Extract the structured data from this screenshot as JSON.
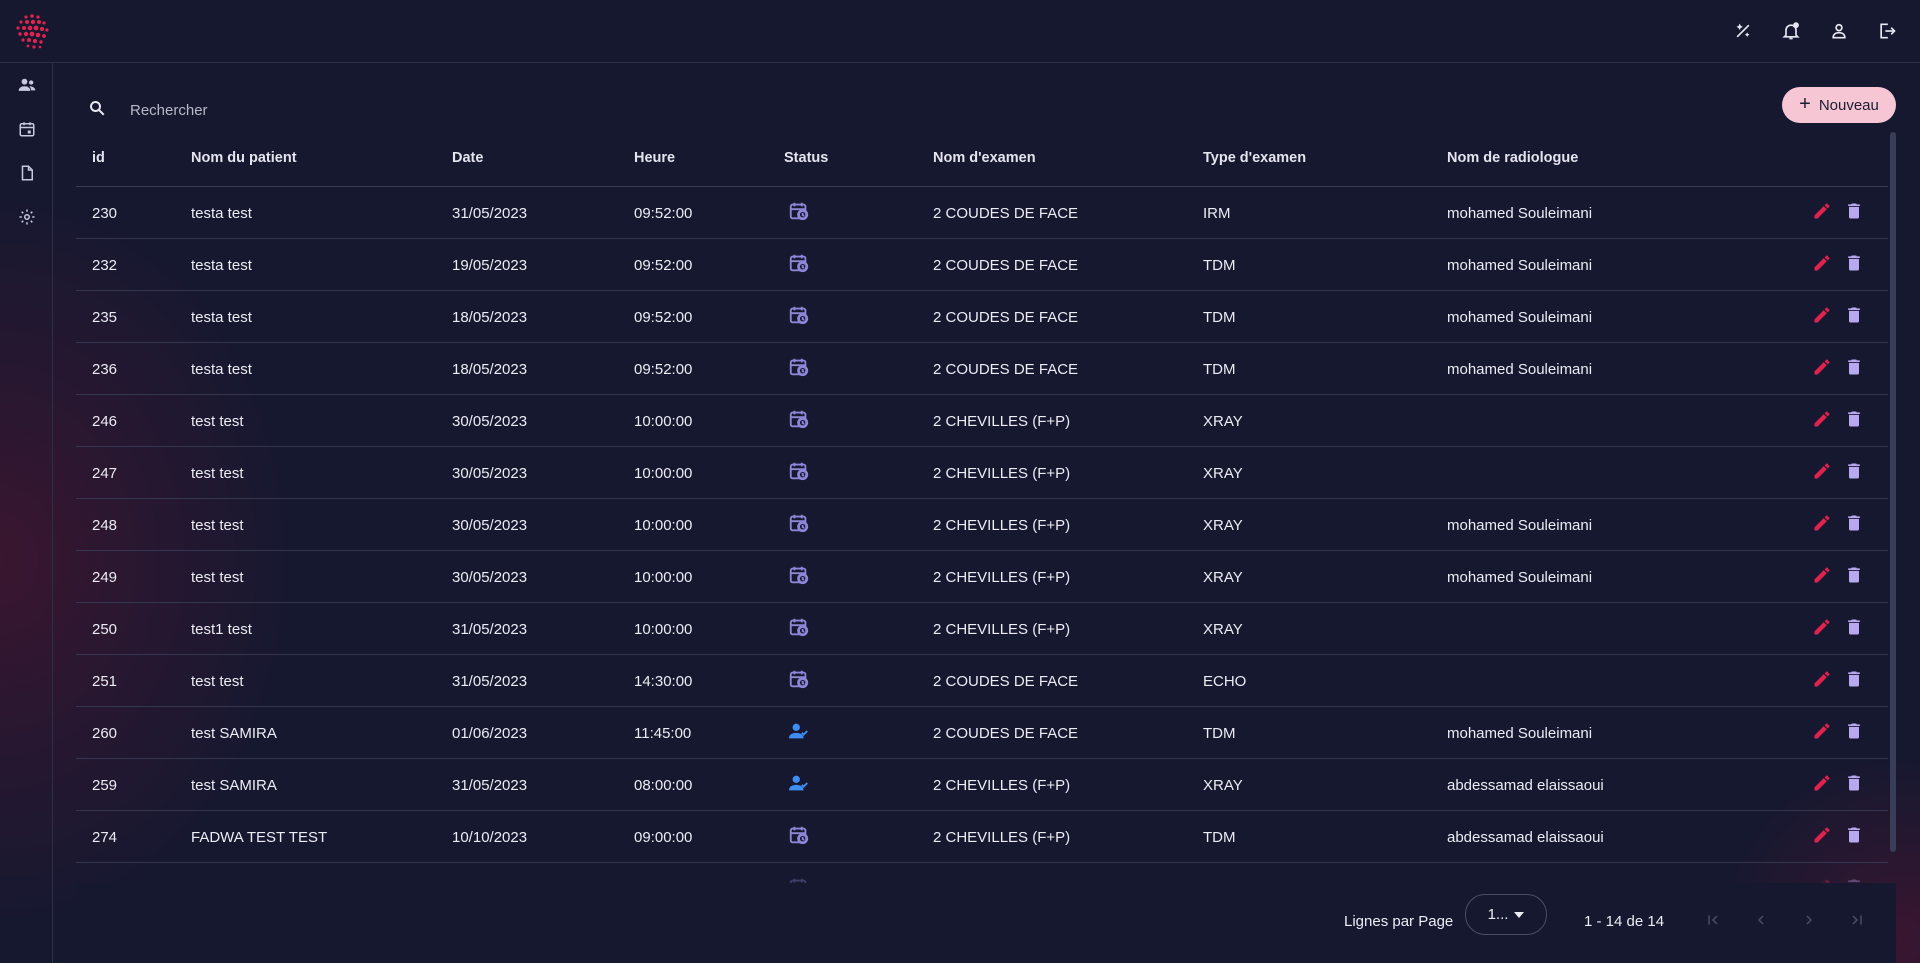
{
  "colors": {
    "background": "#161830",
    "accent_pink": "#f6c6d4",
    "edit_red": "#e0224e",
    "delete_lavender": "#b8a8f0",
    "status_planned": "#8f86d8",
    "status_present": "#3f8cf2"
  },
  "header": {
    "logo_icon": "dotted-sphere-logo",
    "actions": [
      {
        "name": "darkmode-toggle-icon"
      },
      {
        "name": "notifications-icon"
      },
      {
        "name": "profile-icon"
      },
      {
        "name": "logout-icon"
      }
    ]
  },
  "sidebar": {
    "items": [
      {
        "name": "patients-icon"
      },
      {
        "name": "calendar-icon"
      },
      {
        "name": "document-icon"
      },
      {
        "name": "settings-icon"
      }
    ]
  },
  "toolbar": {
    "search_placeholder": "Rechercher",
    "new_label": "Nouveau"
  },
  "table": {
    "columns": [
      "id",
      "Nom du patient",
      "Date",
      "Heure",
      "Status",
      "Nom d'examen",
      "Type d'examen",
      "Nom de radiologue"
    ],
    "rows": [
      {
        "id": "230",
        "patient": "testa test",
        "date": "31/05/2023",
        "heure": "09:52:00",
        "status": "planned",
        "exam": "2 COUDES DE FACE",
        "type": "IRM",
        "radiologue": "mohamed Souleimani"
      },
      {
        "id": "232",
        "patient": "testa test",
        "date": "19/05/2023",
        "heure": "09:52:00",
        "status": "planned",
        "exam": "2 COUDES DE FACE",
        "type": "TDM",
        "radiologue": "mohamed Souleimani"
      },
      {
        "id": "235",
        "patient": "testa test",
        "date": "18/05/2023",
        "heure": "09:52:00",
        "status": "planned",
        "exam": "2 COUDES DE FACE",
        "type": "TDM",
        "radiologue": "mohamed Souleimani"
      },
      {
        "id": "236",
        "patient": "testa test",
        "date": "18/05/2023",
        "heure": "09:52:00",
        "status": "planned",
        "exam": "2 COUDES DE FACE",
        "type": "TDM",
        "radiologue": "mohamed Souleimani"
      },
      {
        "id": "246",
        "patient": "test test",
        "date": "30/05/2023",
        "heure": "10:00:00",
        "status": "planned",
        "exam": "2 CHEVILLES (F+P)",
        "type": "XRAY",
        "radiologue": ""
      },
      {
        "id": "247",
        "patient": "test test",
        "date": "30/05/2023",
        "heure": "10:00:00",
        "status": "planned",
        "exam": "2 CHEVILLES (F+P)",
        "type": "XRAY",
        "radiologue": ""
      },
      {
        "id": "248",
        "patient": "test test",
        "date": "30/05/2023",
        "heure": "10:00:00",
        "status": "planned",
        "exam": "2 CHEVILLES (F+P)",
        "type": "XRAY",
        "radiologue": "mohamed Souleimani"
      },
      {
        "id": "249",
        "patient": "test test",
        "date": "30/05/2023",
        "heure": "10:00:00",
        "status": "planned",
        "exam": "2 CHEVILLES (F+P)",
        "type": "XRAY",
        "radiologue": "mohamed Souleimani"
      },
      {
        "id": "250",
        "patient": "test1 test",
        "date": "31/05/2023",
        "heure": "10:00:00",
        "status": "planned",
        "exam": "2 CHEVILLES (F+P)",
        "type": "XRAY",
        "radiologue": ""
      },
      {
        "id": "251",
        "patient": "test test",
        "date": "31/05/2023",
        "heure": "14:30:00",
        "status": "planned",
        "exam": "2 COUDES DE FACE",
        "type": "ECHO",
        "radiologue": ""
      },
      {
        "id": "260",
        "patient": "test SAMIRA",
        "date": "01/06/2023",
        "heure": "11:45:00",
        "status": "present",
        "exam": "2 COUDES DE FACE",
        "type": "TDM",
        "radiologue": "mohamed Souleimani"
      },
      {
        "id": "259",
        "patient": "test SAMIRA",
        "date": "31/05/2023",
        "heure": "08:00:00",
        "status": "present",
        "exam": "2 CHEVILLES (F+P)",
        "type": "XRAY",
        "radiologue": "abdessamad elaissaoui"
      },
      {
        "id": "274",
        "patient": "FADWA TEST TEST",
        "date": "10/10/2023",
        "heure": "09:00:00",
        "status": "planned",
        "exam": "2 CHEVILLES (F+P)",
        "type": "TDM",
        "radiologue": "abdessamad elaissaoui"
      },
      {
        "id": "",
        "patient": "",
        "date": "",
        "heure": "",
        "status": "planned",
        "exam": "",
        "type": "",
        "radiologue": ""
      }
    ]
  },
  "pagination": {
    "rows_per_page_label": "Lignes par Page",
    "rows_per_page_value": "1...",
    "range_text": "1 - 14 de 14"
  }
}
